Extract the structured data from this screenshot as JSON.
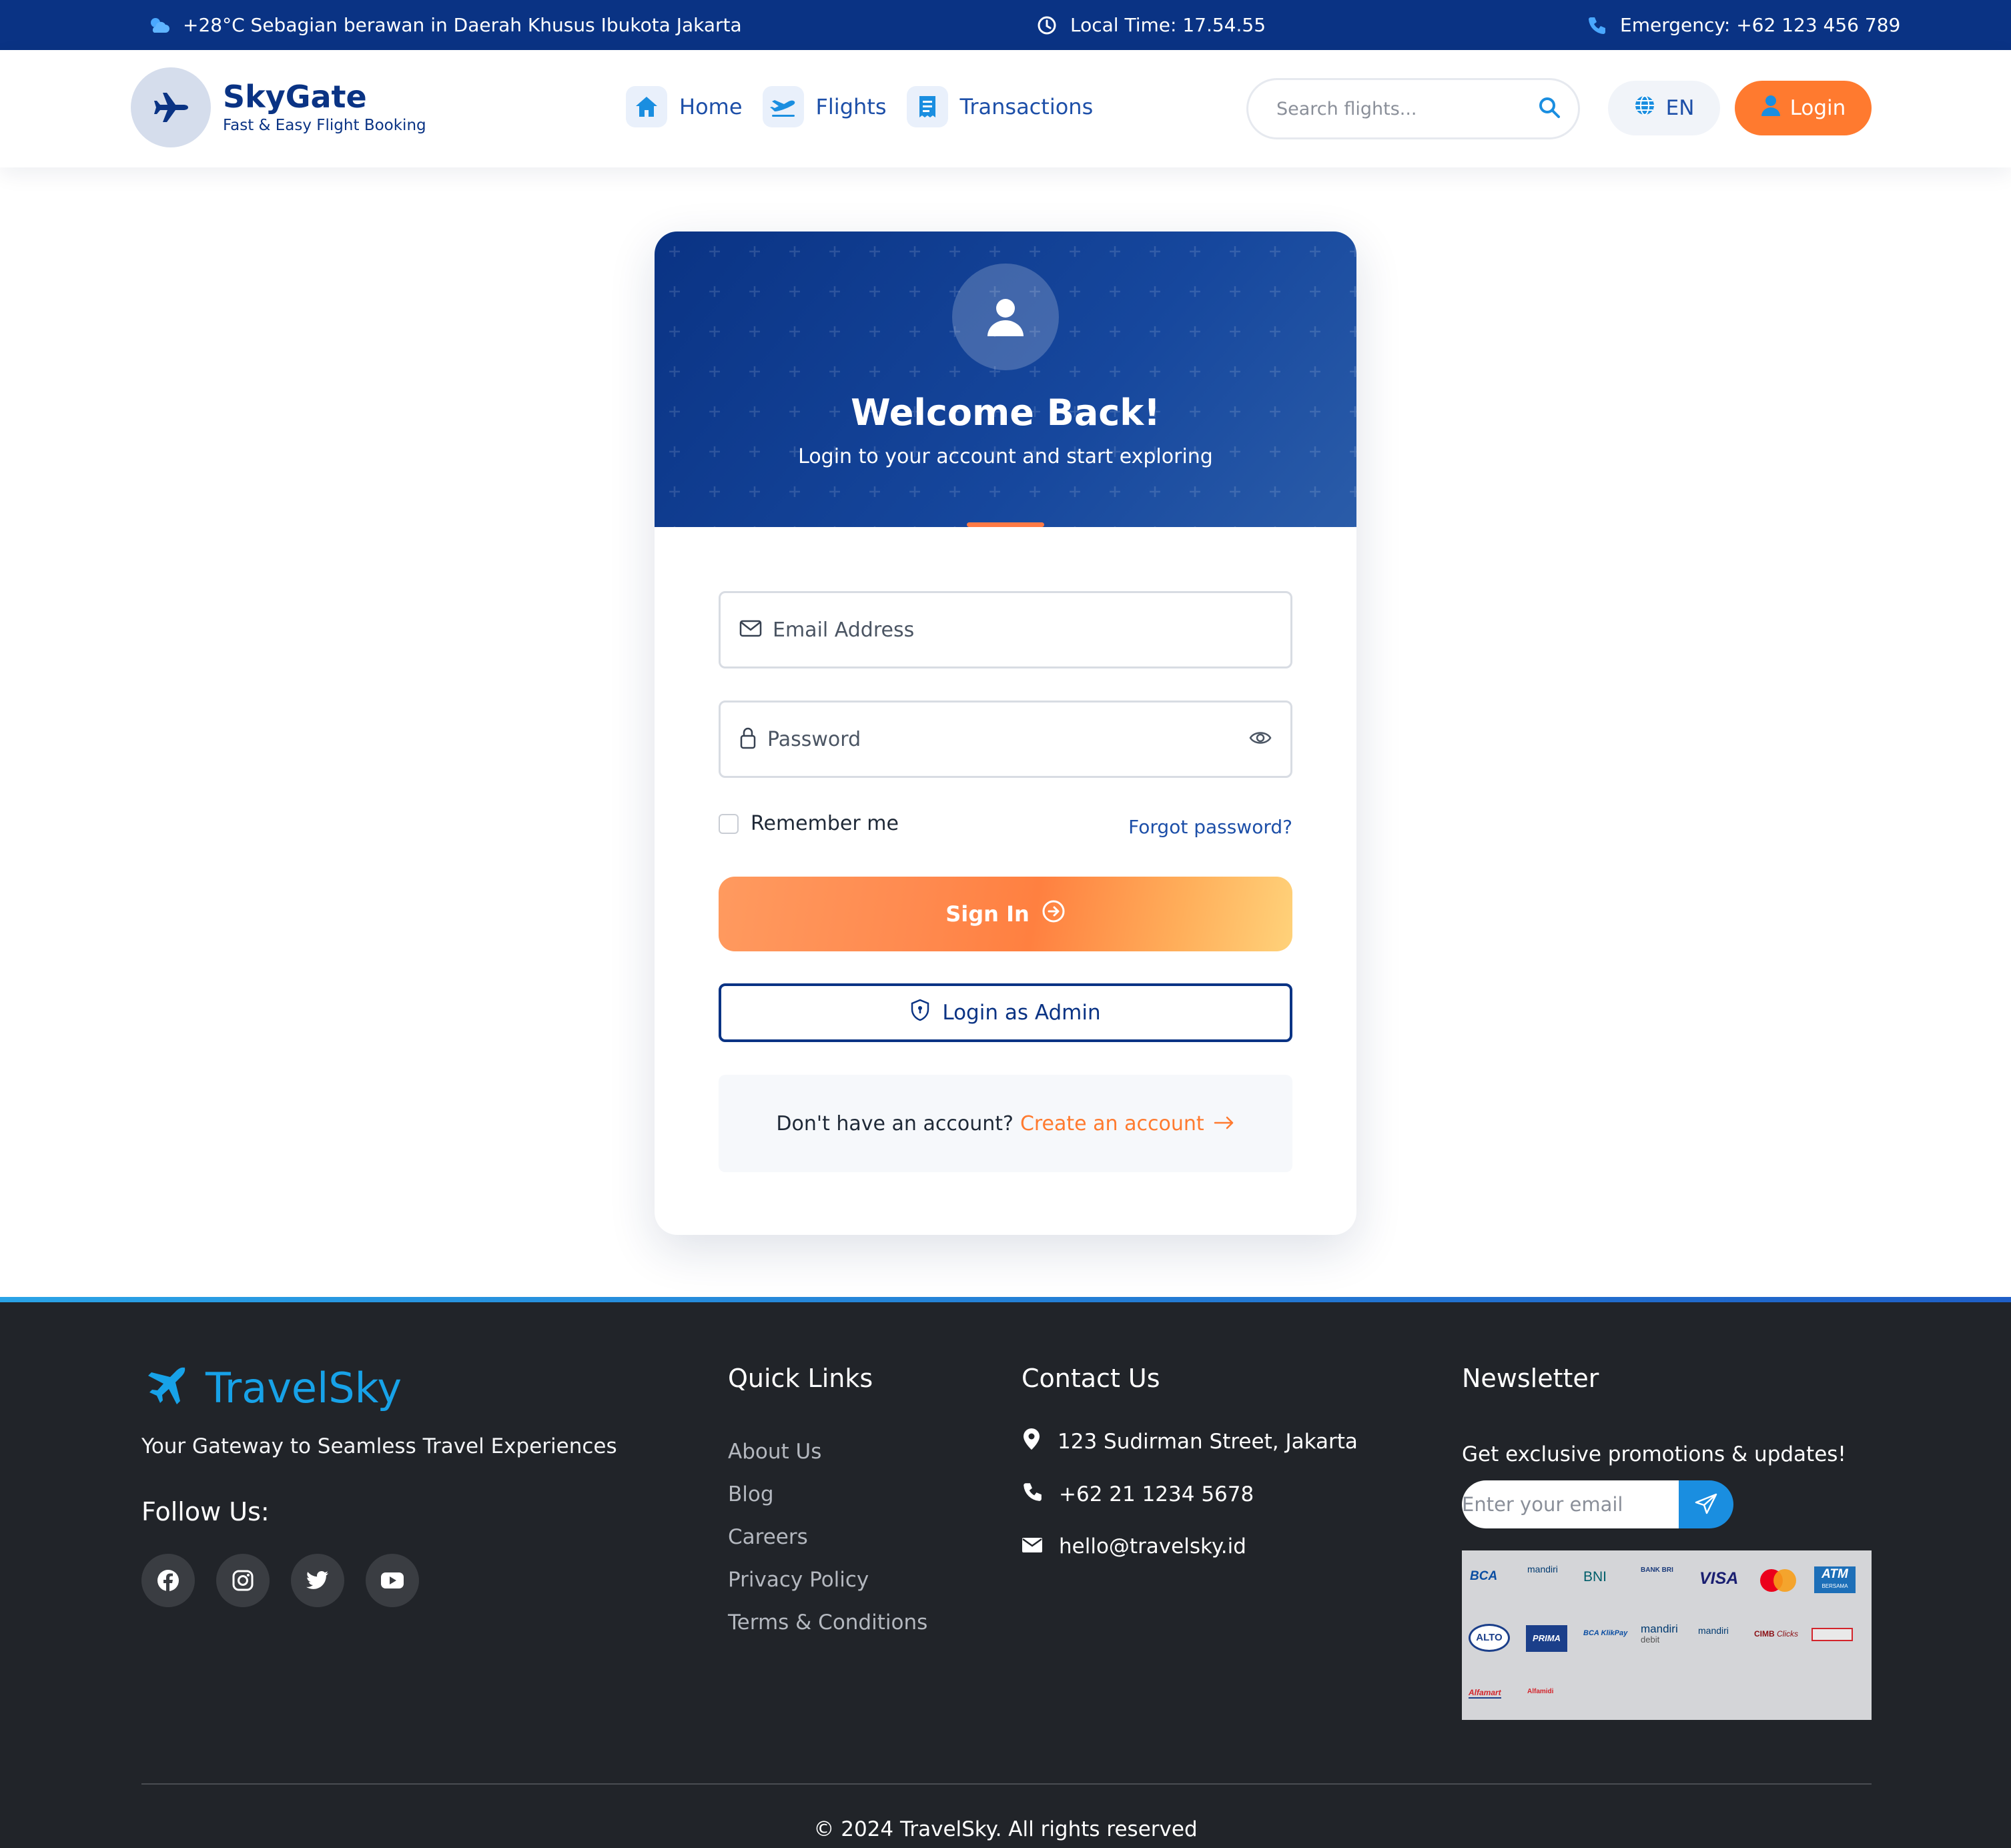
{
  "topbar": {
    "weather": "+28°C Sebagian berawan in Daerah Khusus Ibukota Jakarta",
    "time": "Local Time: 17.54.55",
    "emergency": "Emergency: +62 123 456 789"
  },
  "brand": {
    "name": "SkyGate",
    "tagline": "Fast & Easy Flight Booking"
  },
  "nav": {
    "home": "Home",
    "flights": "Flights",
    "transactions": "Transactions"
  },
  "search": {
    "placeholder": "Search flights..."
  },
  "lang": "EN",
  "login_button": "Login",
  "card": {
    "title": "Welcome Back!",
    "subtitle": "Login to your account and start exploring",
    "email_placeholder": "Email Address",
    "password_placeholder": "Password",
    "remember": "Remember me",
    "forgot": "Forgot password?",
    "signin": "Sign In",
    "admin": "Login as Admin",
    "no_account": "Don't have an account?",
    "create": "Create an account"
  },
  "footer": {
    "brand": "TravelSky",
    "tagline": "Your Gateway to Seamless Travel Experiences",
    "follow": "Follow Us:",
    "quick_links_title": "Quick Links",
    "quick_links": [
      "About Us",
      "Blog",
      "Careers",
      "Privacy Policy",
      "Terms & Conditions"
    ],
    "contact_title": "Contact Us",
    "address": "123 Sudirman Street, Jakarta",
    "phone": "+62 21 1234 5678",
    "email": "hello@travelsky.id",
    "newsletter_title": "Newsletter",
    "newsletter_text": "Get exclusive promotions & updates!",
    "newsletter_placeholder": "Enter your email",
    "payments": {
      "bca": "BCA",
      "mandiri": "mandiri",
      "bni": "BNI",
      "bri": "BANK BRI",
      "visa": "VISA",
      "atm": "ATM",
      "atm_sub": "BERSAMA",
      "alto": "ALTO",
      "prima": "PRIMA",
      "klikpay": "BCA KlikPay",
      "mandiri_debit": "mandiri",
      "debit": "debit",
      "mandiri2": "mandiri",
      "cimb": "CIMB",
      "clicks": "Clicks",
      "alfamart": "Alfamart",
      "alfamidi": "Alfamidi"
    },
    "copyright": "© 2024 TravelSky. All rights reserved"
  },
  "colors": {
    "navy": "#0a3384",
    "orange": "#ff7a2f",
    "sky": "#17a2e8",
    "footer_bg": "#212429"
  }
}
